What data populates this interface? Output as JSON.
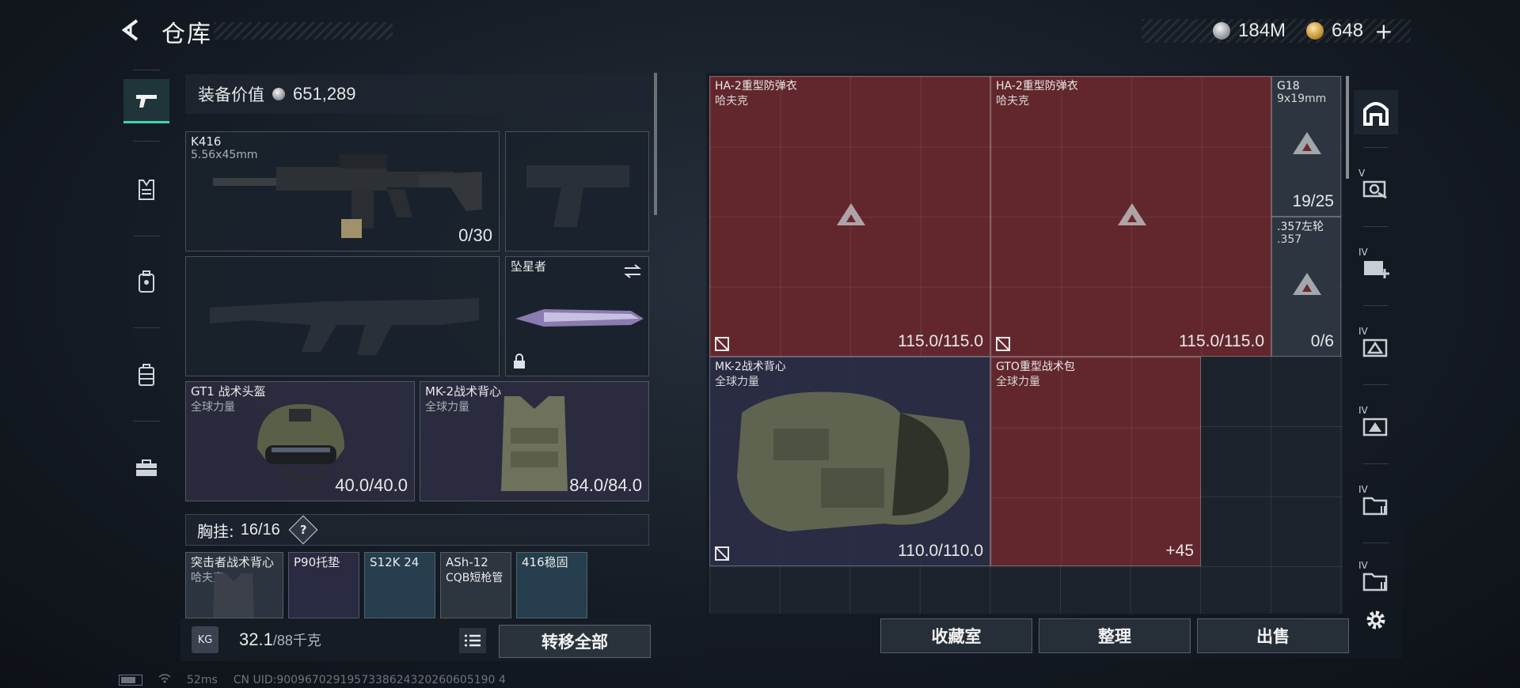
{
  "header": {
    "back_icon": "back-arrow-icon",
    "title": "仓库"
  },
  "currency": {
    "silver": "184M",
    "gold": "648",
    "gold_plus": "+"
  },
  "left_rail": [
    "gun-icon",
    "vest-icon",
    "backpack-icon",
    "chest-rig-icon",
    "case-icon"
  ],
  "equipment": {
    "value_label": "装备价值",
    "value": "651,289",
    "primary": {
      "name": "K416",
      "sub": "5.56x45mm",
      "value": "0/30"
    },
    "melee": {
      "name": "坠星者"
    },
    "helmet": {
      "name": "GT1 战术头盔",
      "sub": "全球力量",
      "value": "40.0/40.0"
    },
    "armor": {
      "name": "MK-2战术背心",
      "sub": "全球力量",
      "value": "84.0/84.0"
    },
    "chest": {
      "label": "胸挂:",
      "count": "16/16",
      "help": "?"
    },
    "chest_items": [
      {
        "name": "突击者战术背心",
        "sub": "哈夫克"
      },
      {
        "name": "P90托垫"
      },
      {
        "name": "S12K 24"
      },
      {
        "name": "ASh-12",
        "sub": "CQB短枪管"
      },
      {
        "name": "416稳固"
      }
    ],
    "weight_icon": "KG",
    "weight": "32.1",
    "weight_max": "/88千克",
    "transfer_all": "转移全部"
  },
  "storage": {
    "items": [
      {
        "name": "HA-2重型防弹衣",
        "sub": "哈夫克",
        "value": "115.0/115.0"
      },
      {
        "name": "HA-2重型防弹衣",
        "sub": "哈夫克",
        "value": "115.0/115.0"
      },
      {
        "name": "G18",
        "sub": "9x19mm",
        "value": "19/25"
      },
      {
        "name": ".357左轮",
        "sub": ".357",
        "value": "0/6"
      },
      {
        "name": "MK-2战术背心",
        "sub": "全球力量",
        "value": "110.0/110.0"
      },
      {
        "name": "GTO重型战术包",
        "sub": "全球力量",
        "value": "+45"
      }
    ],
    "buttons": {
      "collection": "收藏室",
      "organize": "整理",
      "sell": "出售"
    }
  },
  "right_rail": [
    {
      "icon": "safehouse-icon",
      "roman": ""
    },
    {
      "icon": "stash-search-icon",
      "roman": "V"
    },
    {
      "icon": "stash-add-icon",
      "roman": "IV"
    },
    {
      "icon": "stash-ammo-icon",
      "roman": "IV"
    },
    {
      "icon": "stash-triangle-icon",
      "roman": "IV"
    },
    {
      "icon": "stash-folder-icon",
      "roman": "IV"
    },
    {
      "icon": "stash-folder-icon",
      "roman": "IV"
    },
    {
      "icon": "settings-gear-icon",
      "roman": ""
    }
  ],
  "status": {
    "ping": "52ms",
    "uid": "CN UID:9009670291957338624320260605190 4"
  },
  "colors": {
    "accent": "#3ed6b0",
    "storage_red": "#6e282d"
  }
}
